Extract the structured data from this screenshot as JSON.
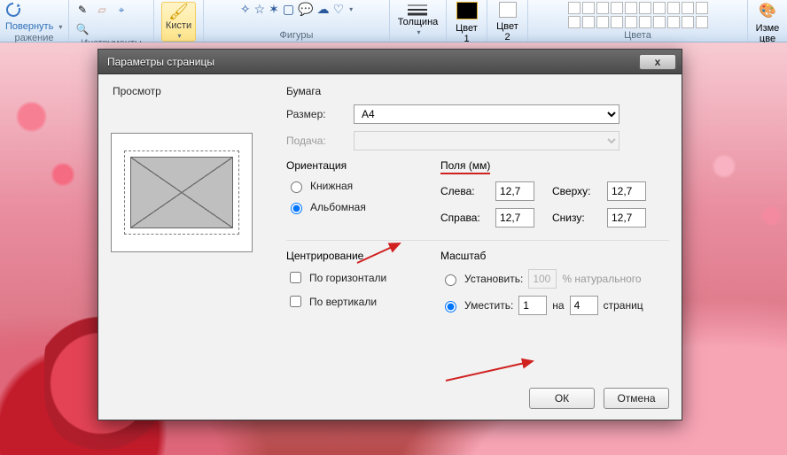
{
  "ribbon": {
    "groups": {
      "rotate": {
        "button": "Повернуть",
        "label": "ражение"
      },
      "tools": {
        "label": "Инструменты"
      },
      "brushes": {
        "button": "Кисти"
      },
      "shapes": {
        "label": "Фигуры"
      },
      "thickness": {
        "button": "Толщина"
      },
      "color1": {
        "button": "Цвет\n1"
      },
      "color2": {
        "button": "Цвет\n2"
      },
      "colors": {
        "label": "Цвета"
      },
      "edit": {
        "button": "Изме\nцве"
      }
    }
  },
  "dialog": {
    "title": "Параметры страницы",
    "preview_label": "Просмотр",
    "paper": {
      "heading": "Бумага",
      "size_label": "Размер:",
      "size_value": "A4",
      "source_label": "Подача:",
      "source_value": ""
    },
    "orientation": {
      "heading": "Ориентация",
      "portrait": "Книжная",
      "landscape": "Альбомная",
      "selected": "landscape"
    },
    "margins": {
      "heading": "Поля (мм)",
      "left_label": "Слева:",
      "left": "12,7",
      "right_label": "Справа:",
      "right": "12,7",
      "top_label": "Сверху:",
      "top": "12,7",
      "bottom_label": "Снизу:",
      "bottom": "12,7"
    },
    "centering": {
      "heading": "Центрирование",
      "horizontal": "По горизонтали",
      "vertical": "По вертикали"
    },
    "scale": {
      "heading": "Масштаб",
      "set_label": "Установить:",
      "set_value": "100",
      "set_suffix": "% натурального",
      "fit_label": "Уместить:",
      "fit_cols": "1",
      "fit_sep": "на",
      "fit_rows": "4",
      "fit_suffix": "страниц",
      "selected": "fit"
    },
    "footer": {
      "ok": "ОК",
      "cancel": "Отмена"
    },
    "close_x": "х"
  }
}
